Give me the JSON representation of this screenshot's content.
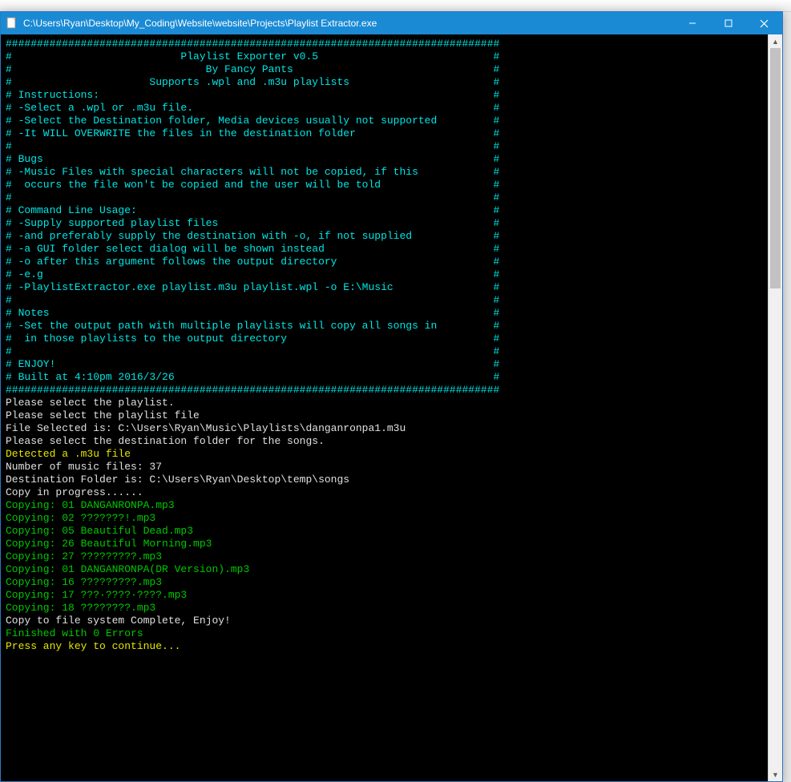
{
  "window": {
    "title": "C:\\Users\\Ryan\\Desktop\\My_Coding\\Website\\website\\Projects\\Playlist Extractor.exe"
  },
  "banner": {
    "border_len": 79,
    "title": "Playlist Exporter v0.5",
    "author": "By Fancy Pants",
    "supports": "Supports .wpl and .m3u playlists",
    "sections": {
      "instructions_h": "Instructions:",
      "instructions": [
        "-Select a .wpl or .m3u file.",
        "-Select the Destination folder, Media devices usually not supported",
        "-It WILL OVERWRITE the files in the destination folder"
      ],
      "bugs_h": "Bugs",
      "bugs": [
        "-Music Files with special characters will not be copied, if this",
        " occurs the file won't be copied and the user will be told"
      ],
      "cli_h": "Command Line Usage:",
      "cli": [
        "-Supply supported playlist files",
        "-and preferably supply the destination with -o, if not supplied",
        "-a GUI folder select dialog will be shown instead",
        "-o after this argument follows the output directory",
        "-e.g",
        "-PlaylistExtractor.exe playlist.m3u playlist.wpl -o E:\\Music"
      ],
      "notes_h": "Notes",
      "notes": [
        "-Set the output path with multiple playlists will copy all songs in",
        " in those playlists to the output directory"
      ],
      "enjoy": "ENJOY!",
      "built": "Built at 4:10pm 2016/3/26"
    }
  },
  "log_white": [
    "Please select the playlist.",
    "Please select the playlist file",
    "File Selected is: C:\\Users\\Ryan\\Music\\Playlists\\danganronpa1.m3u",
    "Please select the destination folder for the songs."
  ],
  "detect_line": "Detected a .m3u file",
  "log_white2": [
    "Number of music files: 37",
    "Destination Folder is: C:\\Users\\Ryan\\Desktop\\temp\\songs",
    "Copy in progress......"
  ],
  "copies": [
    "Copying: 01 DANGANRONPA.mp3",
    "Copying: 02 ???????!.mp3",
    "Copying: 05 Beautiful Dead.mp3",
    "Copying: 26 Beautiful Morning.mp3",
    "Copying: 27 ?????????.mp3",
    "Copying: 01 DANGANRONPA(DR Version).mp3",
    "Copying: 16 ?????????.mp3",
    "Copying: 17 ???·????·????.mp3",
    "Copying: 18 ????????.mp3"
  ],
  "complete_line": "Copy to file system Complete, Enjoy!",
  "errors_line": "Finished with 0 Errors",
  "continue_line": "Press any key to continue..."
}
